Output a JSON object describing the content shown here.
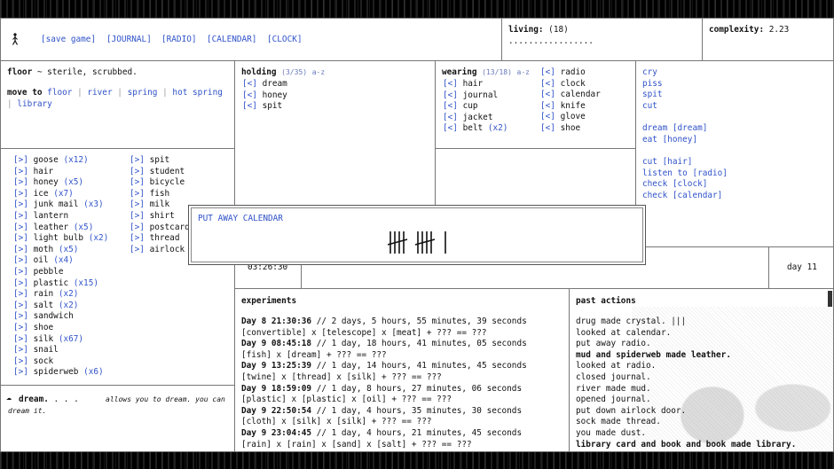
{
  "topbar": {
    "player_icon": "person-icon",
    "menu": [
      "[save game]",
      "[JOURNAL]",
      "[RADIO]",
      "[CALENDAR]",
      "[CLOCK]"
    ]
  },
  "living": {
    "label": "living:",
    "value": "(18)",
    "dots": "................."
  },
  "complexity": {
    "label": "complexity:",
    "value": "2.23"
  },
  "location": {
    "place": "floor",
    "description": " ~ sterile, scrubbed.",
    "move_label": "move to",
    "destinations": [
      "floor",
      "river",
      "spring",
      "hot spring",
      "library"
    ]
  },
  "holding": {
    "title": "holding",
    "count": "(3/35)",
    "sort": "a-z",
    "items": [
      {
        "btn": "[<]",
        "name": "dream"
      },
      {
        "btn": "[<]",
        "name": "honey"
      },
      {
        "btn": "[<]",
        "name": "spit"
      }
    ]
  },
  "wearing": {
    "title": "wearing",
    "count": "(13/18)",
    "sort": "a-z",
    "col1": [
      {
        "btn": "[<]",
        "name": "hair",
        "qty": ""
      },
      {
        "btn": "[<]",
        "name": "journal",
        "qty": ""
      },
      {
        "btn": "[<]",
        "name": "cup",
        "qty": ""
      },
      {
        "btn": "[<]",
        "name": "jacket",
        "qty": ""
      },
      {
        "btn": "[<]",
        "name": "belt",
        "qty": "(x2)"
      }
    ],
    "col2": [
      {
        "btn": "[<]",
        "name": "radio"
      },
      {
        "btn": "[<]",
        "name": "clock"
      },
      {
        "btn": "[<]",
        "name": "calendar"
      },
      {
        "btn": "[<]",
        "name": "knife"
      },
      {
        "btn": "[<]",
        "name": "glove"
      },
      {
        "btn": "[<]",
        "name": "shoe"
      }
    ]
  },
  "actions": {
    "group1": [
      "cry",
      "piss",
      "spit",
      "cut"
    ],
    "group2": [
      "dream [dream]",
      "eat [honey]"
    ],
    "group3": [
      "cut [hair]",
      "listen to [radio]",
      "check [clock]",
      "check [calendar]"
    ]
  },
  "ground": {
    "col1": [
      {
        "btn": "[>]",
        "name": "goose",
        "qty": "(x12)"
      },
      {
        "btn": "[>]",
        "name": "hair",
        "qty": ""
      },
      {
        "btn": "[>]",
        "name": "honey",
        "qty": "(x5)"
      },
      {
        "btn": "[>]",
        "name": "ice",
        "qty": "(x7)"
      },
      {
        "btn": "[>]",
        "name": "junk mail",
        "qty": "(x3)"
      },
      {
        "btn": "[>]",
        "name": "lantern",
        "qty": ""
      },
      {
        "btn": "[>]",
        "name": "leather",
        "qty": "(x5)"
      },
      {
        "btn": "[>]",
        "name": "light bulb",
        "qty": "(x2)"
      },
      {
        "btn": "[>]",
        "name": "moth",
        "qty": "(x5)"
      },
      {
        "btn": "[>]",
        "name": "oil",
        "qty": "(x4)"
      },
      {
        "btn": "[>]",
        "name": "pebble",
        "qty": ""
      },
      {
        "btn": "[>]",
        "name": "plastic",
        "qty": "(x15)"
      },
      {
        "btn": "[>]",
        "name": "rain",
        "qty": "(x2)"
      },
      {
        "btn": "[>]",
        "name": "salt",
        "qty": "(x2)"
      },
      {
        "btn": "[>]",
        "name": "sandwich",
        "qty": ""
      },
      {
        "btn": "[>]",
        "name": "shoe",
        "qty": ""
      },
      {
        "btn": "[>]",
        "name": "silk",
        "qty": "(x67)"
      },
      {
        "btn": "[>]",
        "name": "snail",
        "qty": ""
      },
      {
        "btn": "[>]",
        "name": "sock",
        "qty": ""
      },
      {
        "btn": "[>]",
        "name": "spiderweb",
        "qty": "(x6)"
      }
    ],
    "col2": [
      {
        "btn": "[>]",
        "name": "spit"
      },
      {
        "btn": "[>]",
        "name": "student"
      },
      {
        "btn": "[>]",
        "name": "bicycle"
      },
      {
        "btn": "[>]",
        "name": "fish"
      },
      {
        "btn": "[>]",
        "name": "milk"
      },
      {
        "btn": "[>]",
        "name": "shirt"
      },
      {
        "btn": "[>]",
        "name": "postcard"
      },
      {
        "btn": "[>]",
        "name": "thread"
      },
      {
        "btn": "[>]",
        "name": "airlock d"
      }
    ]
  },
  "inspect": {
    "name": "dream.",
    "dots": " . . .",
    "text": "allows you to dream. you can dream it."
  },
  "popup": {
    "title": "PUT AWAY CALENDAR",
    "tally": "¦¦¦¦ ¦¦¦¦ |"
  },
  "clock": {
    "time": "03:26:30"
  },
  "day": {
    "label": "day",
    "value": "11"
  },
  "experiments": {
    "title": "experiments",
    "entries": [
      {
        "stamp": "Day 8 21:30:36",
        "age": "// 2 days, 5 hours, 55 minutes, 39 seconds",
        "recipe": "[convertible] x [telescope] x [meat] + ??? == ???"
      },
      {
        "stamp": "Day 9 08:45:18",
        "age": "// 1 day, 18 hours, 41 minutes, 05 seconds",
        "recipe": "[fish] x [dream] + ??? == ???"
      },
      {
        "stamp": "Day 9 13:25:39",
        "age": "// 1 day, 14 hours, 41 minutes, 45 seconds",
        "recipe": "[twine] x [thread] x [silk] + ??? == ???"
      },
      {
        "stamp": "Day 9 18:59:09",
        "age": "// 1 day, 8 hours, 27 minutes, 06 seconds",
        "recipe": "[plastic] x [plastic] x [oil] + ??? == ???"
      },
      {
        "stamp": "Day 9 22:50:54",
        "age": "// 1 day, 4 hours, 35 minutes, 30 seconds",
        "recipe": "[cloth] x [silk] x [silk] + ??? == ???"
      },
      {
        "stamp": "Day 9 23:04:45",
        "age": "// 1 day, 4 hours, 21 minutes, 45 seconds",
        "recipe": "[rain] x [rain] x [sand] x [salt] + ??? == ???"
      }
    ]
  },
  "past_actions": {
    "title": "past actions",
    "items": [
      {
        "text": "drug made crystal. |||",
        "bold": false
      },
      {
        "text": "looked at calendar.",
        "bold": false
      },
      {
        "text": "put away radio.",
        "bold": false
      },
      {
        "text": "mud and spiderweb made leather.",
        "bold": true
      },
      {
        "text": "looked at radio.",
        "bold": false
      },
      {
        "text": "closed journal.",
        "bold": false
      },
      {
        "text": "river made mud.",
        "bold": false
      },
      {
        "text": "opened journal.",
        "bold": false
      },
      {
        "text": "put down airlock door.",
        "bold": false
      },
      {
        "text": "sock made thread.",
        "bold": false
      },
      {
        "text": "you made dust.",
        "bold": false
      },
      {
        "text": "library card and book and book made library.",
        "bold": true
      }
    ]
  }
}
